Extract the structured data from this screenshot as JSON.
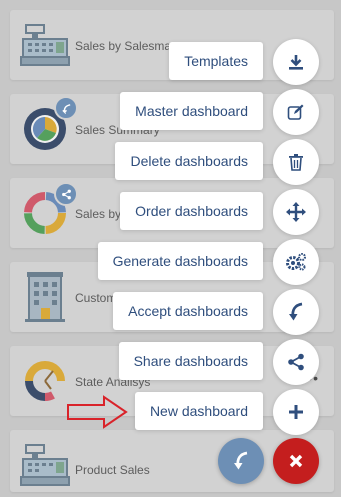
{
  "colors": {
    "accent": "#2f4e7d",
    "close": "#c41e1e",
    "fab_main": "#6d8fb5",
    "arrow_annotation": "#d9232a"
  },
  "dashboards": [
    {
      "name": "Sales by Salesman",
      "icon": "cash-register-icon"
    },
    {
      "name": "Sales Summary",
      "icon": "pie-chart-icon"
    },
    {
      "name": "Sales by",
      "icon": "donut-chart-icon"
    },
    {
      "name": "Custom",
      "icon": "building-icon"
    },
    {
      "name": "State Analisys",
      "icon": "half-donut-chart-icon"
    },
    {
      "name": "Product Sales",
      "icon": "cash-register-icon"
    }
  ],
  "menu": [
    {
      "label": "Templates",
      "icon": "download-icon"
    },
    {
      "label": "Master dashboard",
      "icon": "edit-icon"
    },
    {
      "label": "Delete dashboards",
      "icon": "trash-icon"
    },
    {
      "label": "Order dashboards",
      "icon": "move-arrows-icon"
    },
    {
      "label": "Generate dashboards",
      "icon": "gears-icon"
    },
    {
      "label": "Accept dashboards",
      "icon": "accept-arrow-icon"
    },
    {
      "label": "Share dashboards",
      "icon": "share-icon"
    },
    {
      "label": "New dashboard",
      "icon": "plus-icon"
    }
  ],
  "fab": {
    "main_icon": "curved-arrow-icon",
    "close_icon": "close-icon"
  }
}
